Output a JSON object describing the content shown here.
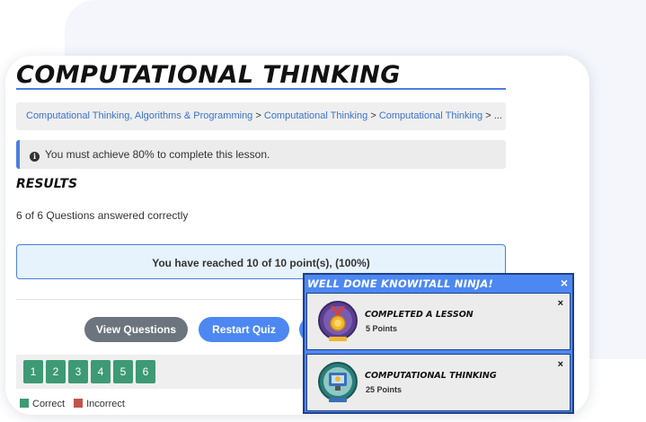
{
  "page": {
    "title": "COMPUTATIONAL THINKING"
  },
  "breadcrumb": {
    "items": [
      "Computational Thinking, Algorithms & Programming",
      "Computational Thinking",
      "Computational Thinking"
    ],
    "separator": ">",
    "ellipsis": "..."
  },
  "notice": {
    "text": "You must achieve 80% to complete this lesson."
  },
  "results": {
    "heading": "RESULTS",
    "count_text": "6 of 6 Questions answered correctly",
    "score_text": "You have reached 10 of 10 point(s), (100%)"
  },
  "buttons": {
    "view_questions": "View Questions",
    "restart_quiz": "Restart Quiz"
  },
  "questions": {
    "numbers": [
      "1",
      "2",
      "3",
      "4",
      "5",
      "6"
    ]
  },
  "legend": {
    "correct": "Correct",
    "incorrect": "Incorrect"
  },
  "popup": {
    "heading": "WELL DONE KNOWITALL NINJA!",
    "close": "×",
    "awards": [
      {
        "title": "COMPLETED A LESSON",
        "points": "5 Points",
        "close": "×"
      },
      {
        "title": "COMPUTATIONAL THINKING",
        "points": "25 Points",
        "close": "×"
      }
    ]
  },
  "colors": {
    "accent": "#4a7fe0",
    "button_primary": "#4d88f2",
    "button_secondary": "#6c757d",
    "correct": "#3d9a75",
    "incorrect": "#c0544a",
    "popup_border": "#1f3f86"
  }
}
